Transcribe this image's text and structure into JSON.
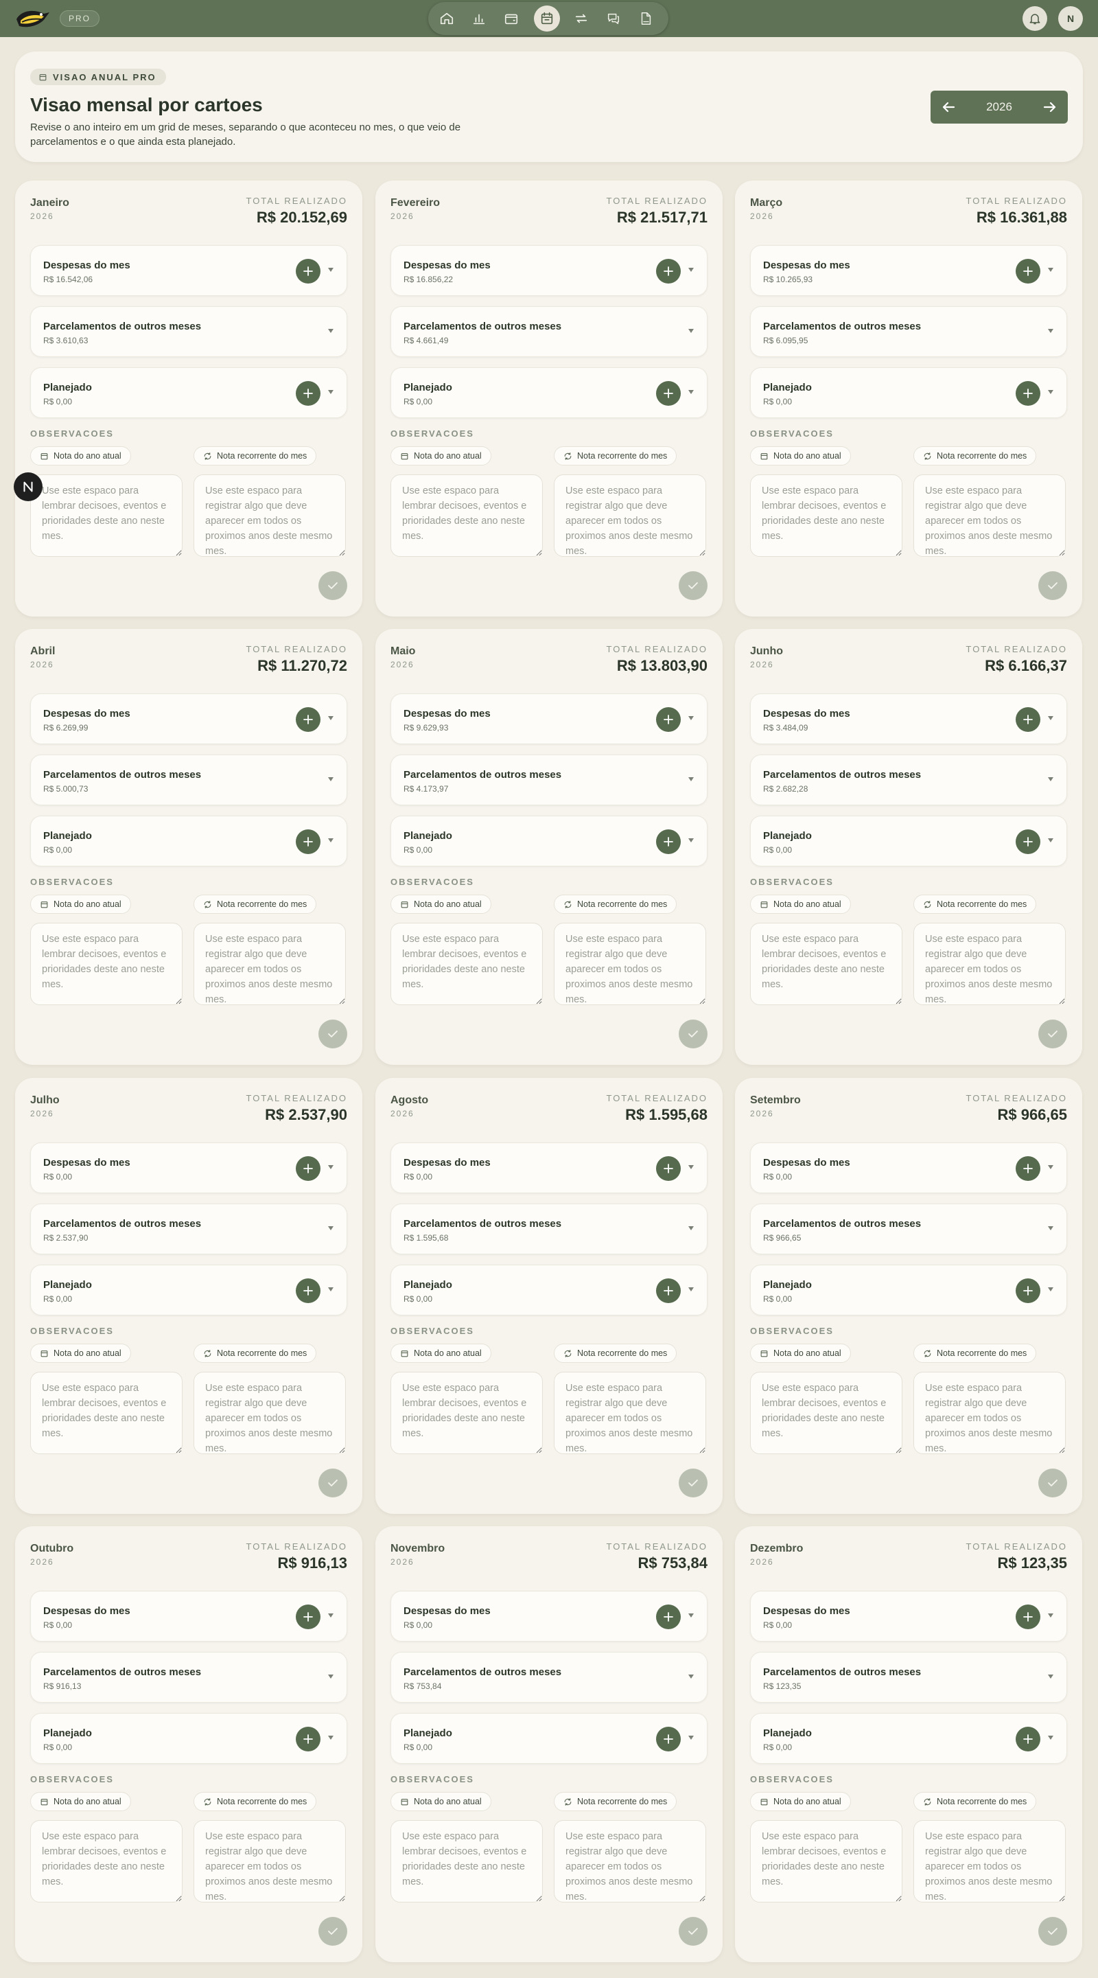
{
  "topbar": {
    "pro_label": "PRO",
    "nav_icons": [
      "home-icon",
      "bar-chart-icon",
      "wallet-icon",
      "calendar-icon",
      "repeat-icon",
      "chat-icon",
      "pdf-icon"
    ],
    "active_nav": "calendar-icon",
    "avatar_initial": "N"
  },
  "header": {
    "badge": "VISAO ANUAL PRO",
    "title": "Visao mensal por cartoes",
    "description": "Revise o ano inteiro em um grid de meses, separando o que aconteceu no mes, o que veio de parcelamentos e o que ainda esta planejado.",
    "year": "2026"
  },
  "labels": {
    "total_label": "TOTAL REALIZADO",
    "expenses": "Despesas do mes",
    "installments": "Parcelamentos de outros meses",
    "planned": "Planejado",
    "observations": "OBSERVACOES",
    "note_current": "Nota do ano atual",
    "note_recurring": "Nota recorrente do mes",
    "placeholder_current": "Use este espaco para lembrar decisoes, eventos e prioridades deste ano neste mes.",
    "placeholder_recurring": "Use este espaco para registrar algo que deve aparecer em todos os proximos anos deste mesmo mes."
  },
  "floating_button_initial": "N",
  "colors": {
    "accent": "#566a4d",
    "topbar": "#5f7256",
    "card": "#f6f4ed",
    "background": "#ede8dc"
  },
  "months": [
    {
      "name": "Janeiro",
      "year": "2026",
      "total": "R$ 20.152,69",
      "expenses": "R$ 16.542,06",
      "installments": "R$ 3.610,63",
      "planned": "R$ 0,00"
    },
    {
      "name": "Fevereiro",
      "year": "2026",
      "total": "R$ 21.517,71",
      "expenses": "R$ 16.856,22",
      "installments": "R$ 4.661,49",
      "planned": "R$ 0,00"
    },
    {
      "name": "Março",
      "year": "2026",
      "total": "R$ 16.361,88",
      "expenses": "R$ 10.265,93",
      "installments": "R$ 6.095,95",
      "planned": "R$ 0,00"
    },
    {
      "name": "Abril",
      "year": "2026",
      "total": "R$ 11.270,72",
      "expenses": "R$ 6.269,99",
      "installments": "R$ 5.000,73",
      "planned": "R$ 0,00"
    },
    {
      "name": "Maio",
      "year": "2026",
      "total": "R$ 13.803,90",
      "expenses": "R$ 9.629,93",
      "installments": "R$ 4.173,97",
      "planned": "R$ 0,00"
    },
    {
      "name": "Junho",
      "year": "2026",
      "total": "R$ 6.166,37",
      "expenses": "R$ 3.484,09",
      "installments": "R$ 2.682,28",
      "planned": "R$ 0,00"
    },
    {
      "name": "Julho",
      "year": "2026",
      "total": "R$ 2.537,90",
      "expenses": "R$ 0,00",
      "installments": "R$ 2.537,90",
      "planned": "R$ 0,00"
    },
    {
      "name": "Agosto",
      "year": "2026",
      "total": "R$ 1.595,68",
      "expenses": "R$ 0,00",
      "installments": "R$ 1.595,68",
      "planned": "R$ 0,00"
    },
    {
      "name": "Setembro",
      "year": "2026",
      "total": "R$ 966,65",
      "expenses": "R$ 0,00",
      "installments": "R$ 966,65",
      "planned": "R$ 0,00"
    },
    {
      "name": "Outubro",
      "year": "2026",
      "total": "R$ 916,13",
      "expenses": "R$ 0,00",
      "installments": "R$ 916,13",
      "planned": "R$ 0,00"
    },
    {
      "name": "Novembro",
      "year": "2026",
      "total": "R$ 753,84",
      "expenses": "R$ 0,00",
      "installments": "R$ 753,84",
      "planned": "R$ 0,00"
    },
    {
      "name": "Dezembro",
      "year": "2026",
      "total": "R$ 123,35",
      "expenses": "R$ 0,00",
      "installments": "R$ 123,35",
      "planned": "R$ 0,00"
    }
  ]
}
